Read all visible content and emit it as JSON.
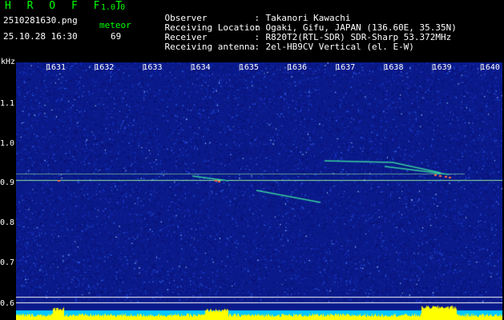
{
  "header": {
    "app_title": "H R O F F T",
    "app_version": "1.0.0",
    "file_name": "2510281630.png",
    "date_time": "25.10.28 16:30",
    "meteor_label": "meteor",
    "meteor_count": "69"
  },
  "info": [
    {
      "label": "Observer",
      "value": "Takanori Kawachi"
    },
    {
      "label": "Receiving Location",
      "value": "Ogaki, Gifu, JAPAN (136.60E, 35.35N)"
    },
    {
      "label": "Receiver",
      "value": "R820T2(RTL-SDR) SDR-Sharp 53.372MHz"
    },
    {
      "label": "Receiving antenna",
      "value": "2el-HB9CV Vertical (el. E-W)"
    }
  ],
  "axis": {
    "y_unit": "kHz",
    "y_ticks": [
      "1.1",
      "1.0",
      "0.9",
      "0.8",
      "0.7",
      "0.6"
    ],
    "x_ticks": [
      "1631",
      "1632",
      "1633",
      "1634",
      "1635",
      "1636",
      "1637",
      "1638",
      "1639",
      "1640"
    ]
  },
  "colors": {
    "background": "#000000",
    "spectrogram": "#0a1a8a",
    "signal_line": "#8fe8a0",
    "meteor_trace": "#38d0a0",
    "peak": "#ff6a3a",
    "level_bar": "#ffff00",
    "level_floor": "#00c8ff"
  }
}
